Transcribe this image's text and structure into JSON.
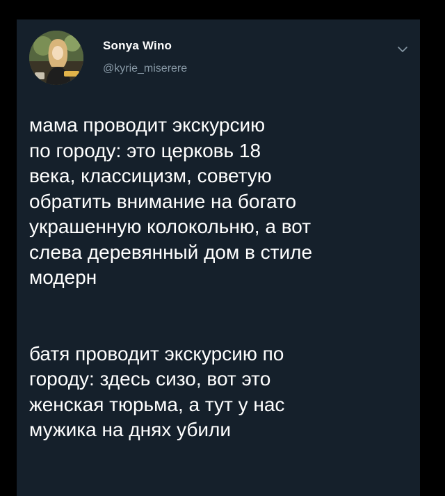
{
  "tweet": {
    "author": {
      "display_name": "Sonya Wino",
      "handle": "@kyrie_miserere",
      "avatar_icon": "profile-photo"
    },
    "menu_icon": "chevron-down-icon",
    "text_paragraphs": [
      "мама проводит экскурсию\nпо городу: это церковь 18\nвека, классицизм, советую\nобратить внимание на богато\nукрашенную колокольню, а вот\nслева деревянный дом в стиле\nмодерн",
      "батя проводит экскурсию по\nгороду: здесь сизо, вот это\nженская тюрьма, а тут у нас\nмужика на днях убили"
    ]
  },
  "colors": {
    "page_background": "#000000",
    "card_background": "#15202b",
    "primary_text": "#ffffff",
    "secondary_text": "#8899a6"
  }
}
